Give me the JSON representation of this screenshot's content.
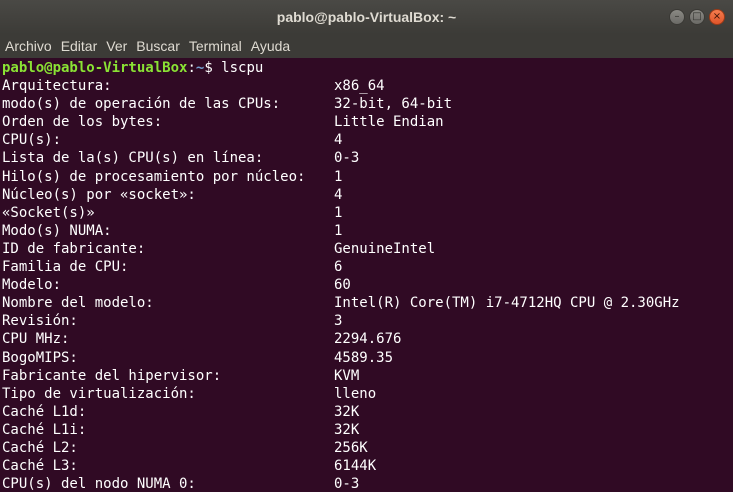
{
  "window": {
    "title": "pablo@pablo-VirtualBox: ~",
    "controls": {
      "minimize": "–",
      "maximize": "□",
      "close": "×"
    }
  },
  "menu": [
    "Archivo",
    "Editar",
    "Ver",
    "Buscar",
    "Terminal",
    "Ayuda"
  ],
  "prompt": {
    "user_host": "pablo@pablo-VirtualBox",
    "separator": ":",
    "path": "~",
    "symbol": "$ ",
    "command": "lscpu"
  },
  "rows": [
    {
      "key": "Arquitectura:",
      "value": "x86_64"
    },
    {
      "key": "modo(s) de operación de las CPUs:",
      "value": "32-bit, 64-bit"
    },
    {
      "key": "Orden de los bytes:",
      "value": "Little Endian"
    },
    {
      "key": "CPU(s):",
      "value": "4"
    },
    {
      "key": "Lista de la(s) CPU(s) en línea:",
      "value": "0-3"
    },
    {
      "key": "Hilo(s) de procesamiento por núcleo:",
      "value": "1"
    },
    {
      "key": "Núcleo(s) por «socket»:",
      "value": "4"
    },
    {
      "key": "«Socket(s)»",
      "value": "1"
    },
    {
      "key": "Modo(s) NUMA:",
      "value": "1"
    },
    {
      "key": "ID de fabricante:",
      "value": "GenuineIntel"
    },
    {
      "key": "Familia de CPU:",
      "value": "6"
    },
    {
      "key": "Modelo:",
      "value": "60"
    },
    {
      "key": "Nombre del modelo:",
      "value": "Intel(R) Core(TM) i7-4712HQ CPU @ 2.30GHz"
    },
    {
      "key": "Revisión:",
      "value": "3"
    },
    {
      "key": "CPU MHz:",
      "value": "2294.676"
    },
    {
      "key": "BogoMIPS:",
      "value": "4589.35"
    },
    {
      "key": "Fabricante del hipervisor:",
      "value": "KVM"
    },
    {
      "key": "Tipo de virtualización:",
      "value": "lleno"
    },
    {
      "key": "Caché L1d:",
      "value": "32K"
    },
    {
      "key": "Caché L1i:",
      "value": "32K"
    },
    {
      "key": "Caché L2:",
      "value": "256K"
    },
    {
      "key": "Caché L3:",
      "value": "6144K"
    },
    {
      "key": "CPU(s) del nodo NUMA 0:",
      "value": "0-3"
    }
  ]
}
